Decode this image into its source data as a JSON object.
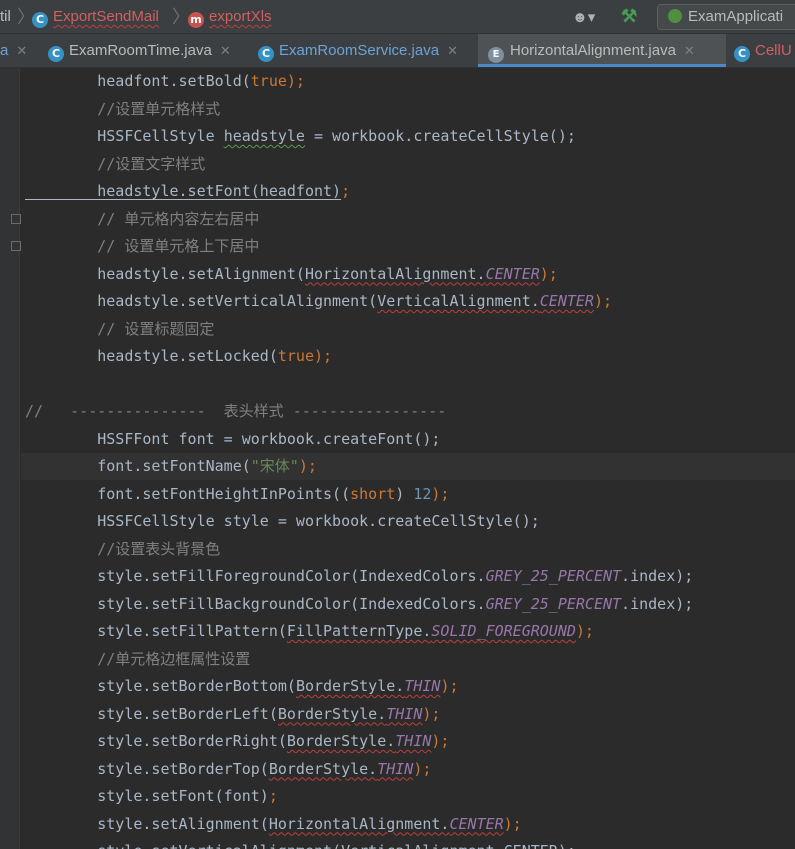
{
  "breadcrumb": {
    "items": [
      {
        "label": "til"
      },
      {
        "label": "ExportSendMail",
        "icon": "class-icon"
      },
      {
        "label": "exportXls",
        "icon": "method-icon"
      }
    ]
  },
  "toolbar": {
    "run_config_label": "ExamApplicati"
  },
  "tabs": [
    {
      "label": "a",
      "icon": "class-icon",
      "state": "partial"
    },
    {
      "label": "ExamRoomTime.java",
      "icon": "class-icon"
    },
    {
      "label": "ExamRoomService.java",
      "icon": "class-icon"
    },
    {
      "label": "HorizontalAlignment.java",
      "icon": "enum-icon",
      "active": true
    },
    {
      "label": "CellU",
      "icon": "class-icon",
      "state": "partial"
    }
  ],
  "code": {
    "lines": [
      {
        "segments": [
          {
            "t": "        headfont.setBold(",
            "c": ""
          },
          {
            "t": "true",
            "c": "kw"
          },
          {
            "t": ");",
            "c": "kw"
          }
        ]
      },
      {
        "segments": [
          {
            "t": "        //设置单元格样式",
            "c": "cm"
          }
        ]
      },
      {
        "segments": [
          {
            "t": "        HSSFCellStyle ",
            "c": ""
          },
          {
            "t": "headstyle",
            "c": "wg"
          },
          {
            "t": " = workbook.createCellStyle();",
            "c": ""
          }
        ]
      },
      {
        "segments": [
          {
            "t": "        //设置文字样式",
            "c": "cm"
          }
        ]
      },
      {
        "segments": [
          {
            "t": "        headstyle.setFont(headfont)",
            "c": "ul"
          },
          {
            "t": ";",
            "c": "kw"
          }
        ]
      },
      {
        "segments": [
          {
            "t": "        // 单元格内容左右居中",
            "c": "cm"
          }
        ]
      },
      {
        "segments": [
          {
            "t": "        // 设置单元格上下居中",
            "c": "cm"
          }
        ]
      },
      {
        "segments": [
          {
            "t": "        headstyle.setAlignment(",
            "c": ""
          },
          {
            "t": "HorizontalAlignment.",
            "c": "wv"
          },
          {
            "t": "CENTER",
            "c": "const wv"
          },
          {
            "t": ");",
            "c": "kw"
          }
        ]
      },
      {
        "segments": [
          {
            "t": "        headstyle.setVerticalAlignment(",
            "c": ""
          },
          {
            "t": "VerticalAlignment.",
            "c": "wv"
          },
          {
            "t": "CENTER",
            "c": "const wv"
          },
          {
            "t": ");",
            "c": "kw"
          }
        ]
      },
      {
        "segments": [
          {
            "t": "        // 设置标题固定",
            "c": "cm"
          }
        ]
      },
      {
        "segments": [
          {
            "t": "        headstyle.setLocked(",
            "c": ""
          },
          {
            "t": "true",
            "c": "kw"
          },
          {
            "t": ");",
            "c": "kw"
          }
        ]
      },
      {
        "segments": [
          {
            "t": "",
            "c": ""
          }
        ]
      },
      {
        "segments": [
          {
            "t": "//   ---------------  表头样式 -----------------",
            "c": "cm"
          }
        ]
      },
      {
        "segments": [
          {
            "t": "        HSSFFont font = workbook.createFont();",
            "c": ""
          }
        ]
      },
      {
        "segments": [
          {
            "t": "        font.setFontName(",
            "c": ""
          },
          {
            "t": "\"宋体\"",
            "c": "str"
          },
          {
            "t": ");",
            "c": "kw"
          }
        ],
        "current": true
      },
      {
        "segments": [
          {
            "t": "        font.setFontHeightInPoints((",
            "c": ""
          },
          {
            "t": "short",
            "c": "kw"
          },
          {
            "t": ") ",
            "c": ""
          },
          {
            "t": "12",
            "c": "num"
          },
          {
            "t": ");",
            "c": "kw"
          }
        ]
      },
      {
        "segments": [
          {
            "t": "        HSSFCellStyle style = workbook.createCellStyle();",
            "c": ""
          }
        ]
      },
      {
        "segments": [
          {
            "t": "        //设置表头背景色",
            "c": "cm"
          }
        ]
      },
      {
        "segments": [
          {
            "t": "        style.setFillForegroundColor(IndexedColors.",
            "c": ""
          },
          {
            "t": "GREY_25_PERCENT",
            "c": "const"
          },
          {
            "t": ".index);",
            "c": ""
          }
        ]
      },
      {
        "segments": [
          {
            "t": "        style.setFillBackgroundColor(IndexedColors.",
            "c": ""
          },
          {
            "t": "GREY_25_PERCENT",
            "c": "const"
          },
          {
            "t": ".index);",
            "c": ""
          }
        ]
      },
      {
        "segments": [
          {
            "t": "        style.setFillPattern(",
            "c": ""
          },
          {
            "t": "FillPatternType.",
            "c": "wv"
          },
          {
            "t": "SOLID_FOREGROUND",
            "c": "const wv"
          },
          {
            "t": ");",
            "c": "kw"
          }
        ]
      },
      {
        "segments": [
          {
            "t": "        //单元格边框属性设置",
            "c": "cm"
          }
        ]
      },
      {
        "segments": [
          {
            "t": "        style.setBorderBottom(",
            "c": ""
          },
          {
            "t": "BorderStyle.",
            "c": "wv"
          },
          {
            "t": "THIN",
            "c": "const wv"
          },
          {
            "t": ");",
            "c": "kw"
          }
        ]
      },
      {
        "segments": [
          {
            "t": "        style.setBorderLeft(",
            "c": ""
          },
          {
            "t": "BorderStyle.",
            "c": "wv"
          },
          {
            "t": "THIN",
            "c": "const wv"
          },
          {
            "t": ");",
            "c": "kw"
          }
        ]
      },
      {
        "segments": [
          {
            "t": "        style.setBorderRight(",
            "c": ""
          },
          {
            "t": "BorderStyle.",
            "c": "wv"
          },
          {
            "t": "THIN",
            "c": "const wv"
          },
          {
            "t": ");",
            "c": "kw"
          }
        ]
      },
      {
        "segments": [
          {
            "t": "        style.setBorderTop(",
            "c": ""
          },
          {
            "t": "BorderStyle.",
            "c": "wv"
          },
          {
            "t": "THIN",
            "c": "const wv"
          },
          {
            "t": ");",
            "c": "kw"
          }
        ]
      },
      {
        "segments": [
          {
            "t": "        style.setFont(font)",
            "c": ""
          },
          {
            "t": ";",
            "c": "kw"
          }
        ]
      },
      {
        "segments": [
          {
            "t": "        style.setAlignment(",
            "c": ""
          },
          {
            "t": "HorizontalAlignment.",
            "c": "wv"
          },
          {
            "t": "CENTER",
            "c": "const wv"
          },
          {
            "t": ");",
            "c": "kw"
          }
        ]
      },
      {
        "segments": [
          {
            "t": "        style.setVerticalAlignment(VerticalAlignment.CENTER);",
            "c": ""
          }
        ]
      }
    ]
  }
}
